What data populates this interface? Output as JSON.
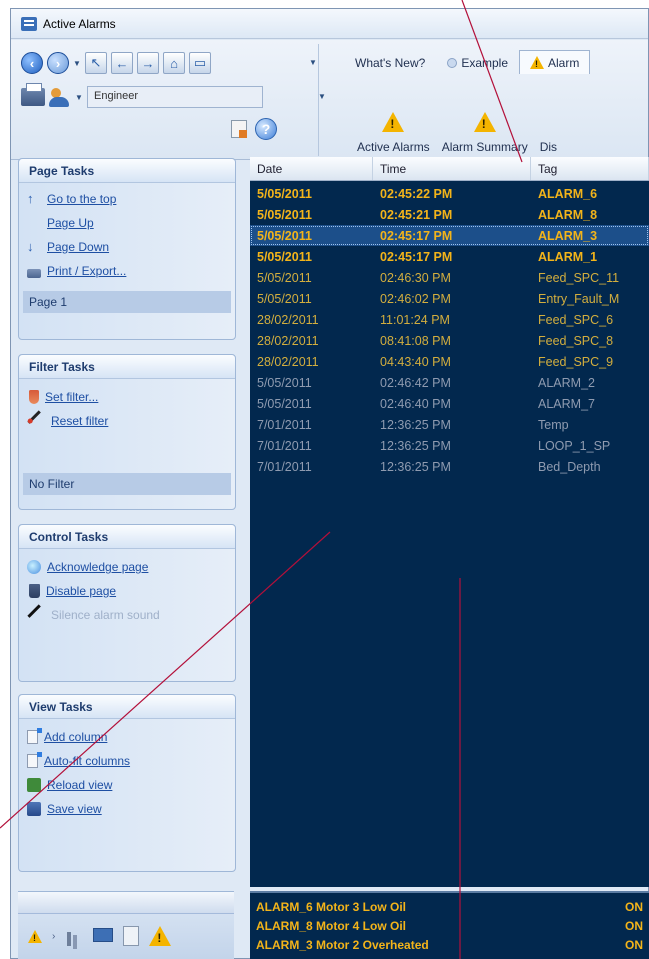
{
  "window": {
    "title": "Active Alarms"
  },
  "toolbar": {
    "user": "Engineer",
    "tabs": [
      {
        "label": "What's New?"
      },
      {
        "label": "Example"
      },
      {
        "label": "Alarm"
      }
    ],
    "ribbon": [
      {
        "label": "Active Alarms"
      },
      {
        "label": "Alarm Summary"
      },
      {
        "label": "Dis"
      }
    ]
  },
  "sidebar": {
    "page_tasks": {
      "title": "Page Tasks",
      "items": [
        {
          "label": "Go to the top"
        },
        {
          "label": "Page Up"
        },
        {
          "label": "Page Down"
        },
        {
          "label": "Print / Export..."
        }
      ],
      "status": "Page 1"
    },
    "filter_tasks": {
      "title": "Filter Tasks",
      "items": [
        {
          "label": "Set filter..."
        },
        {
          "label": "Reset filter"
        }
      ],
      "status": "No Filter"
    },
    "control_tasks": {
      "title": "Control Tasks",
      "items": [
        {
          "label": "Acknowledge page"
        },
        {
          "label": "Disable page"
        },
        {
          "label": "Silence alarm sound"
        }
      ]
    },
    "view_tasks": {
      "title": "View Tasks",
      "items": [
        {
          "label": "Add column"
        },
        {
          "label": "Auto-fit columns"
        },
        {
          "label": "Reload view"
        },
        {
          "label": "Save view"
        }
      ]
    }
  },
  "grid": {
    "columns": [
      "Date",
      "Time",
      "Tag"
    ],
    "rows": [
      {
        "date": "5/05/2011",
        "time": "02:45:22 PM",
        "tag": "ALARM_6",
        "state": "unack"
      },
      {
        "date": "5/05/2011",
        "time": "02:45:21 PM",
        "tag": "ALARM_8",
        "state": "unack"
      },
      {
        "date": "5/05/2011",
        "time": "02:45:17 PM",
        "tag": "ALARM_3",
        "state": "unack-selected"
      },
      {
        "date": "5/05/2011",
        "time": "02:45:17 PM",
        "tag": "ALARM_1",
        "state": "unack"
      },
      {
        "date": "5/05/2011",
        "time": "02:46:30 PM",
        "tag": "Feed_SPC_11",
        "state": "ack"
      },
      {
        "date": "5/05/2011",
        "time": "02:46:02 PM",
        "tag": "Entry_Fault_M",
        "state": "ack"
      },
      {
        "date": "28/02/2011",
        "time": "11:01:24 PM",
        "tag": "Feed_SPC_6",
        "state": "ack"
      },
      {
        "date": "28/02/2011",
        "time": "08:41:08 PM",
        "tag": "Feed_SPC_8",
        "state": "ack"
      },
      {
        "date": "28/02/2011",
        "time": "04:43:40 PM",
        "tag": "Feed_SPC_9",
        "state": "ack"
      },
      {
        "date": "5/05/2011",
        "time": "02:46:42 PM",
        "tag": "ALARM_2",
        "state": "normal"
      },
      {
        "date": "5/05/2011",
        "time": "02:46:40 PM",
        "tag": "ALARM_7",
        "state": "normal"
      },
      {
        "date": "7/01/2011",
        "time": "12:36:25 PM",
        "tag": "Temp",
        "state": "normal"
      },
      {
        "date": "7/01/2011",
        "time": "12:36:25 PM",
        "tag": "LOOP_1_SP",
        "state": "normal"
      },
      {
        "date": "7/01/2011",
        "time": "12:36:25 PM",
        "tag": "Bed_Depth",
        "state": "normal"
      }
    ]
  },
  "banner": {
    "rows": [
      {
        "text": "ALARM_6 Motor 3 Low Oil",
        "state": "ON"
      },
      {
        "text": "ALARM_8 Motor 4 Low Oil",
        "state": "ON"
      },
      {
        "text": "ALARM_3 Motor 2 Overheated",
        "state": "ON"
      }
    ]
  },
  "colors": {
    "grid_background": "#02284e",
    "unacknowledged": "#f3b41a",
    "acknowledged": "#d3ae3e",
    "normal": "#8f9bb0",
    "selected_row": "#1c4f8a"
  }
}
